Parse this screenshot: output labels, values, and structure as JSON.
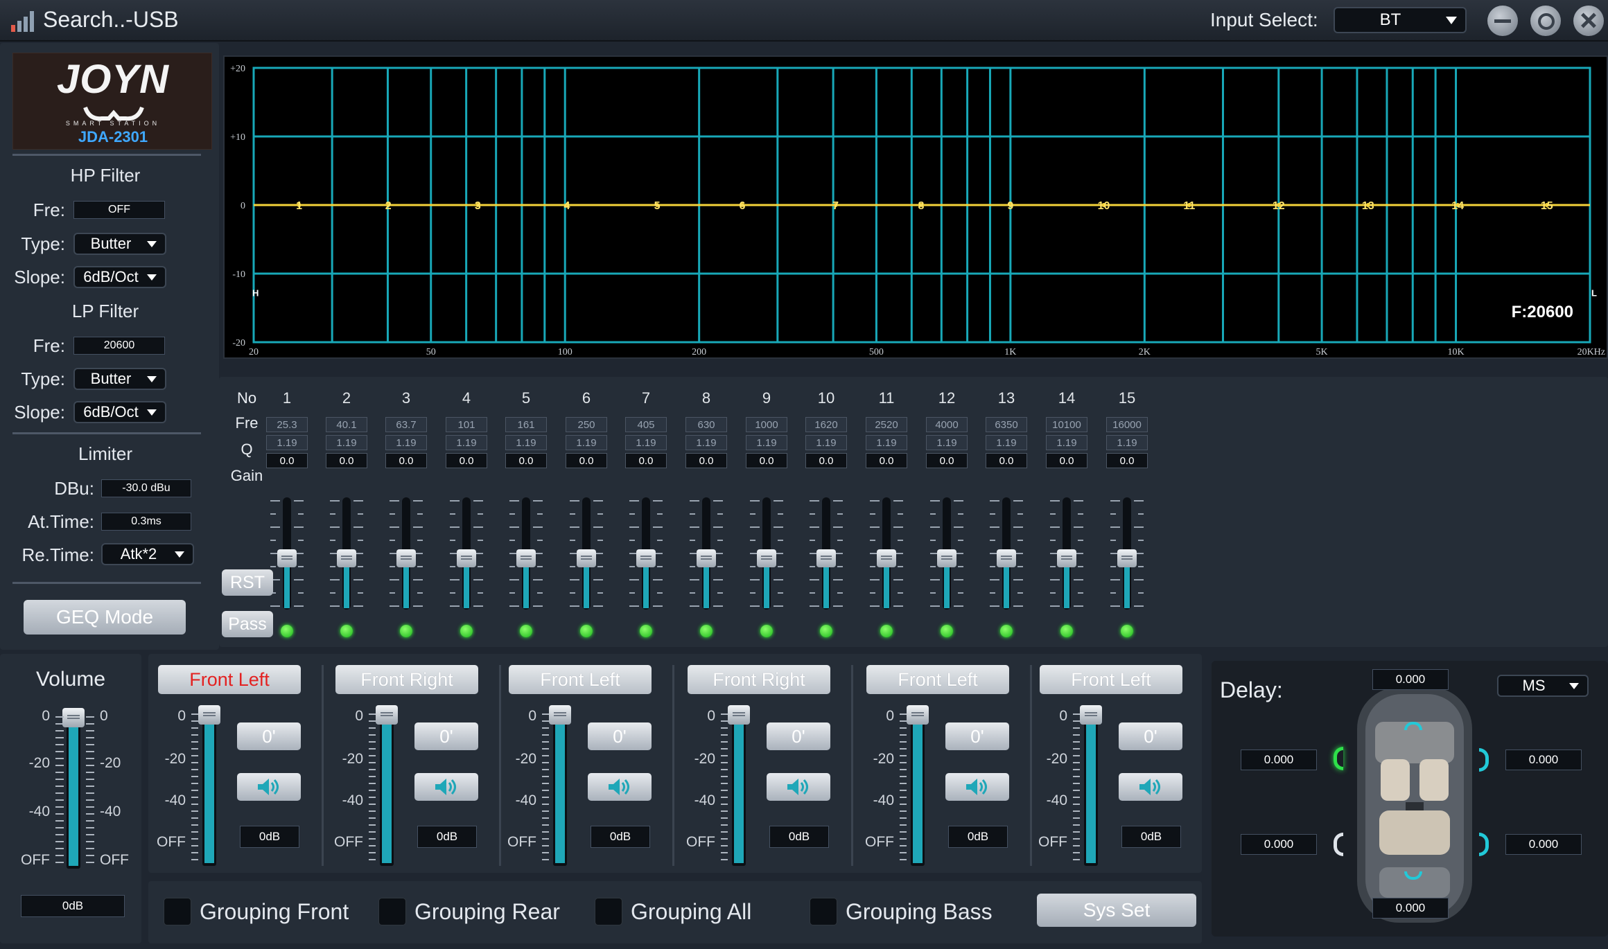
{
  "window": {
    "title": "Search..-USB",
    "input_select_label": "Input Select:",
    "input_select_value": "BT"
  },
  "logo": {
    "brand": "JOYN",
    "tagline": "SMART STATION",
    "model": "JDA-2301"
  },
  "hp_filter": {
    "title": "HP Filter",
    "fre_label": "Fre:",
    "fre_value": "OFF",
    "type_label": "Type:",
    "type_value": "Butter",
    "slope_label": "Slope:",
    "slope_value": "6dB/Oct"
  },
  "lp_filter": {
    "title": "LP Filter",
    "fre_label": "Fre:",
    "fre_value": "20600",
    "type_label": "Type:",
    "type_value": "Butter",
    "slope_label": "Slope:",
    "slope_value": "6dB/Oct"
  },
  "limiter": {
    "title": "Limiter",
    "dbu_label": "DBu:",
    "dbu_value": "-30.0 dBu",
    "attime_label": "At.Time:",
    "attime_value": "0.3ms",
    "retime_label": "Re.Time:",
    "retime_value": "Atk*2"
  },
  "geq_button": "GEQ Mode",
  "graph": {
    "y_labels": [
      "+20",
      "+10",
      "0",
      "-10",
      "-20"
    ],
    "x_labels": [
      "20",
      "50",
      "100",
      "200",
      "500",
      "1K",
      "2K",
      "5K",
      "10K",
      "20KHz"
    ],
    "readout": "F:20600",
    "band_markers": [
      "1",
      "2",
      "3",
      "4",
      "5",
      "6",
      "7",
      "8",
      "9",
      "10",
      "11",
      "12",
      "13",
      "14",
      "15"
    ],
    "curve_color": "#f5d33a",
    "grid_color": "#18a8b8",
    "edge_markers": [
      "H",
      "L"
    ]
  },
  "chart_data": {
    "type": "line",
    "x_scale": "log",
    "xlim": [
      20,
      20000
    ],
    "ylim": [
      -20,
      20
    ],
    "series": [
      {
        "x": [
          25.3,
          40.1,
          63.7,
          101,
          161,
          250,
          405,
          630,
          1000,
          1620,
          2520,
          4000,
          6350,
          10100,
          16000
        ],
        "y": [
          0,
          0,
          0,
          0,
          0,
          0,
          0,
          0,
          0,
          0,
          0,
          0,
          0,
          0,
          0
        ]
      }
    ]
  },
  "eq": {
    "row_labels": {
      "no": "No",
      "fre": "Fre",
      "q": "Q",
      "gain": "Gain"
    },
    "bands": [
      {
        "no": "1",
        "fre": "25.3",
        "q": "1.19",
        "gain": "0.0",
        "level": 0.5
      },
      {
        "no": "2",
        "fre": "40.1",
        "q": "1.19",
        "gain": "0.0",
        "level": 0.5
      },
      {
        "no": "3",
        "fre": "63.7",
        "q": "1.19",
        "gain": "0.0",
        "level": 0.5
      },
      {
        "no": "4",
        "fre": "101",
        "q": "1.19",
        "gain": "0.0",
        "level": 0.5
      },
      {
        "no": "5",
        "fre": "161",
        "q": "1.19",
        "gain": "0.0",
        "level": 0.5
      },
      {
        "no": "6",
        "fre": "250",
        "q": "1.19",
        "gain": "0.0",
        "level": 0.5
      },
      {
        "no": "7",
        "fre": "405",
        "q": "1.19",
        "gain": "0.0",
        "level": 0.5
      },
      {
        "no": "8",
        "fre": "630",
        "q": "1.19",
        "gain": "0.0",
        "level": 0.5
      },
      {
        "no": "9",
        "fre": "1000",
        "q": "1.19",
        "gain": "0.0",
        "level": 0.5
      },
      {
        "no": "10",
        "fre": "1620",
        "q": "1.19",
        "gain": "0.0",
        "level": 0.5
      },
      {
        "no": "11",
        "fre": "2520",
        "q": "1.19",
        "gain": "0.0",
        "level": 0.5
      },
      {
        "no": "12",
        "fre": "4000",
        "q": "1.19",
        "gain": "0.0",
        "level": 0.5
      },
      {
        "no": "13",
        "fre": "6350",
        "q": "1.19",
        "gain": "0.0",
        "level": 0.5
      },
      {
        "no": "14",
        "fre": "10100",
        "q": "1.19",
        "gain": "0.0",
        "level": 0.5
      },
      {
        "no": "15",
        "fre": "16000",
        "q": "1.19",
        "gain": "0.0",
        "level": 0.5
      }
    ],
    "rst_label": "RST",
    "pass_label": "Pass"
  },
  "volume": {
    "title": "Volume",
    "scale": [
      "0",
      "-20",
      "-40",
      "OFF"
    ],
    "value": "0dB",
    "level": 1.0
  },
  "channels": [
    {
      "name": "Front Left",
      "active": true,
      "phase": "0'",
      "value": "0dB",
      "level": 1.0
    },
    {
      "name": "Front Right",
      "active": false,
      "phase": "0'",
      "value": "0dB",
      "level": 1.0
    },
    {
      "name": "Front Left",
      "active": false,
      "phase": "0'",
      "value": "0dB",
      "level": 1.0
    },
    {
      "name": "Front Right",
      "active": false,
      "phase": "0'",
      "value": "0dB",
      "level": 1.0
    },
    {
      "name": "Front Left",
      "active": false,
      "phase": "0'",
      "value": "0dB",
      "level": 1.0
    },
    {
      "name": "Front Left",
      "active": false,
      "phase": "0'",
      "value": "0dB",
      "level": 1.0
    }
  ],
  "channel_scale": [
    "0",
    "-20",
    "-40",
    "OFF"
  ],
  "grouping": {
    "front": "Grouping Front",
    "rear": "Grouping Rear",
    "all": "Grouping All",
    "bass": "Grouping Bass",
    "sys_set": "Sys Set"
  },
  "delay": {
    "title": "Delay:",
    "unit": "MS",
    "top": "0.000",
    "left_front": "0.000",
    "right_front": "0.000",
    "left_rear": "0.000",
    "right_rear": "0.000",
    "bottom": "0.000"
  },
  "colors": {
    "accent": "#1fa7b8",
    "active_channel": "#e32222",
    "led": "#2bd42b"
  }
}
